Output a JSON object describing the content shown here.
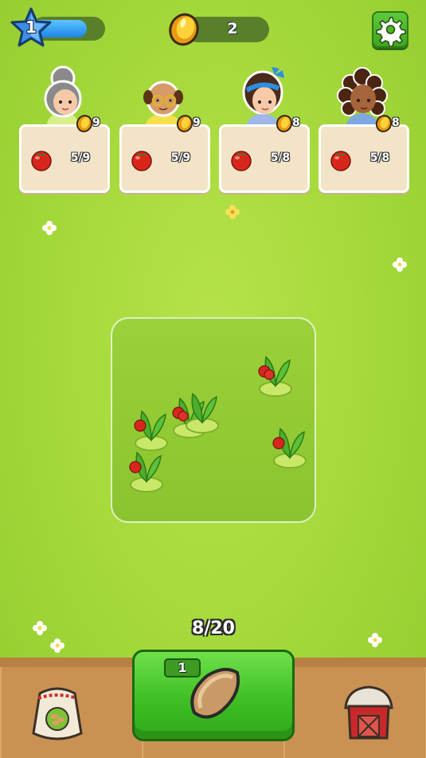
{
  "hud": {
    "level": "1",
    "xp_progress": 0.75,
    "coins": "2",
    "settings_icon": "gear-icon"
  },
  "customers": [
    {
      "avatar": "grandma-avatar",
      "reward": "9",
      "item_icon": "tomato-icon",
      "progress": "5/9"
    },
    {
      "avatar": "bald-man-glasses-avatar",
      "reward": "9",
      "item_icon": "tomato-icon",
      "progress": "5/9"
    },
    {
      "avatar": "girl-blue-bow-avatar",
      "reward": "8",
      "item_icon": "tomato-icon",
      "progress": "5/8"
    },
    {
      "avatar": "curly-hair-woman-avatar",
      "reward": "8",
      "item_icon": "tomato-icon",
      "progress": "5/8"
    }
  ],
  "field": {
    "plants": [
      "tomato-plant",
      "tomato-plant",
      "tomato-plant",
      "tomato-plant",
      "tomato-plant",
      "tomato-plant"
    ]
  },
  "storage": {
    "capacity": "8/20"
  },
  "bottom_bar": {
    "seed_bag_icon": "seed-bag-icon",
    "plant_button": {
      "seed_count": "1",
      "icon": "seed-icon"
    },
    "barn_icon": "barn-icon"
  },
  "colors": {
    "grass": "#a4d83a",
    "button_green": "#3fbf25",
    "xp_blue": "#1d86e8",
    "card": "#f3e4c8"
  }
}
